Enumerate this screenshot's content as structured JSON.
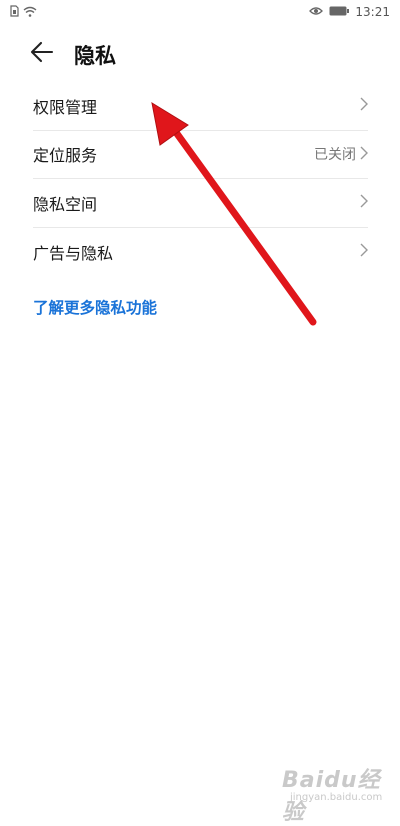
{
  "status_bar": {
    "time": "13:21",
    "icons": [
      "sim-icon",
      "wifi-icon",
      "eye-icon",
      "battery-icon"
    ]
  },
  "header": {
    "title": "隐私",
    "back_icon": "back-arrow-icon"
  },
  "menu": {
    "items": [
      {
        "label": "权限管理",
        "status": ""
      },
      {
        "label": "定位服务",
        "status": "已关闭"
      },
      {
        "label": "隐私空间",
        "status": ""
      },
      {
        "label": "广告与隐私",
        "status": ""
      }
    ]
  },
  "learn_more": {
    "label": "了解更多隐私功能",
    "color": "#1a73d8"
  },
  "annotation": {
    "arrow_color": "#e0161b"
  },
  "watermark": {
    "logo": "Baidu经验",
    "url": "jingyan.baidu.com"
  }
}
